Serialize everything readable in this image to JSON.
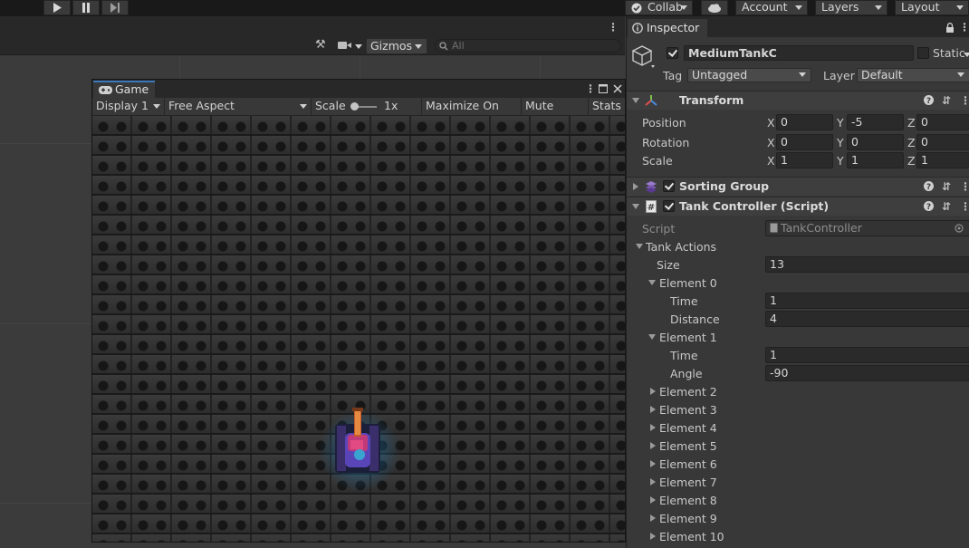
{
  "toolbar": {
    "collab_label": "Collab",
    "account_label": "Account",
    "layers_label": "Layers",
    "layout_label": "Layout"
  },
  "scene_toolbar": {
    "gizmos_label": "Gizmos",
    "search_placeholder": "All"
  },
  "game": {
    "tab_label": "Game",
    "display": "Display 1",
    "aspect": "Free Aspect",
    "scale_label": "Scale",
    "scale_value": "1x",
    "maximize_label": "Maximize On Play",
    "mute_label": "Mute Audio",
    "stats_label": "Stats"
  },
  "inspector": {
    "tab_label": "Inspector",
    "object_name": "MediumTankC",
    "static_label": "Static",
    "tag_label": "Tag",
    "tag_value": "Untagged",
    "layer_label": "Layer",
    "layer_value": "Default",
    "transform": {
      "title": "Transform",
      "rows": [
        {
          "label": "Position",
          "x": "0",
          "y": "-5",
          "z": "0"
        },
        {
          "label": "Rotation",
          "x": "0",
          "y": "0",
          "z": "0"
        },
        {
          "label": "Scale",
          "x": "1",
          "y": "1",
          "z": "1"
        }
      ],
      "axis_x": "X",
      "axis_y": "Y",
      "axis_z": "Z"
    },
    "sorting_group_title": "Sorting Group",
    "tank_controller": {
      "title": "Tank Controller (Script)",
      "script_label": "Script",
      "script_value": "TankController",
      "actions_label": "Tank Actions",
      "size_label": "Size",
      "size_value": "13",
      "element0": {
        "label": "Element 0",
        "time_label": "Time",
        "time_value": "1",
        "distance_label": "Distance",
        "distance_value": "4"
      },
      "element1": {
        "label": "Element 1",
        "time_label": "Time",
        "time_value": "1",
        "angle_label": "Angle",
        "angle_value": "-90"
      },
      "collapsed": [
        "Element 2",
        "Element 3",
        "Element 4",
        "Element 5",
        "Element 6",
        "Element 7",
        "Element 8",
        "Element 9",
        "Element 10"
      ]
    }
  }
}
